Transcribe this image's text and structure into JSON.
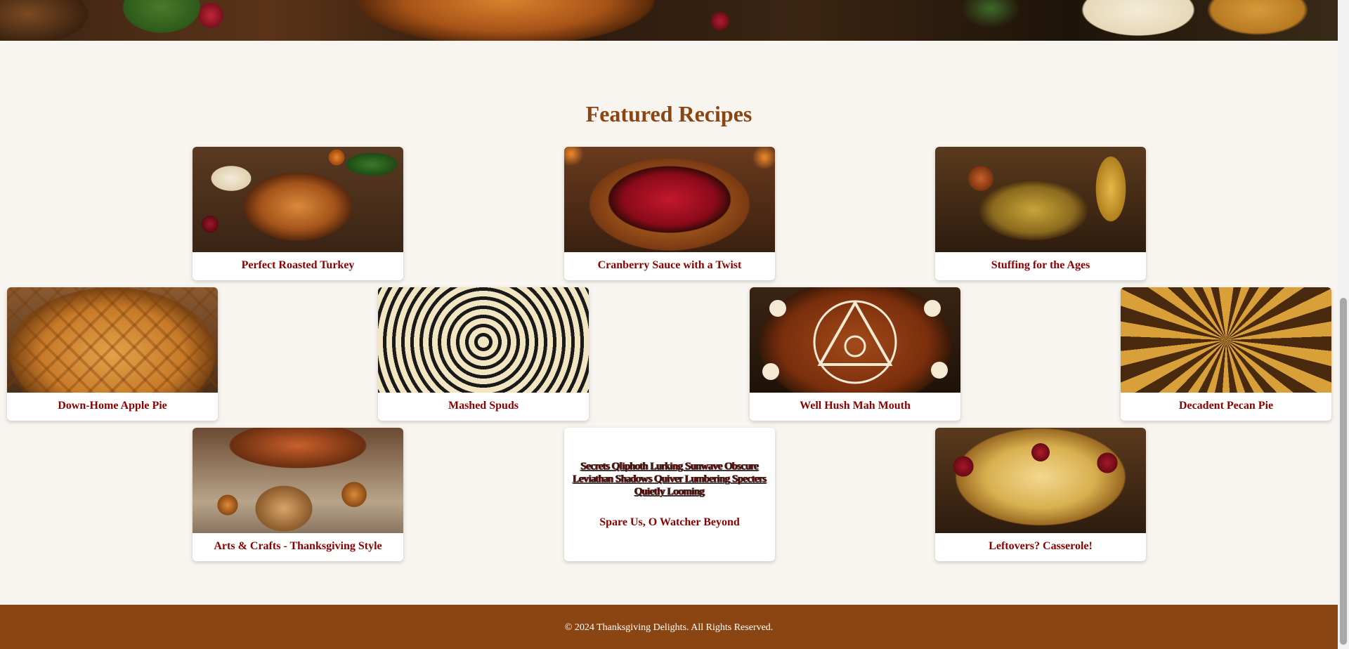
{
  "section": {
    "title": "Featured Recipes"
  },
  "recipes": [
    {
      "title": "Perfect Roasted Turkey",
      "image": "roasted-turkey-image"
    },
    {
      "title": "Cranberry Sauce with a Twist",
      "image": "cranberry-sauce-image"
    },
    {
      "title": "Stuffing for the Ages",
      "image": "stuffing-image"
    },
    {
      "title": "Down-Home Apple Pie",
      "image": "apple-pie-image"
    },
    {
      "title": "Mashed Spuds",
      "image": "mashed-potatoes-image"
    },
    {
      "title": "Well Hush Mah Mouth",
      "image": "pumpkin-pie-image"
    },
    {
      "title": "Decadent Pecan Pie",
      "image": "pecan-pie-image"
    },
    {
      "title": "Arts & Crafts - Thanksgiving Style",
      "image": "table-crafts-image"
    },
    {
      "title": "Spare Us, O Watcher Beyond",
      "image_alt_text": "Secrets Qliphoth Lurking Sunwave Obscure Leviathan Shadows Quiver Lumbering Specters Quietly Looming"
    },
    {
      "title": "Leftovers? Casserole!",
      "image": "casserole-image"
    }
  ],
  "footer": {
    "text": "© 2024 Thanksgiving Delights. All Rights Reserved."
  },
  "colors": {
    "background": "#f8f4ef",
    "heading": "#8b4513",
    "card_title": "#8b0000",
    "footer": "#8b4513"
  }
}
